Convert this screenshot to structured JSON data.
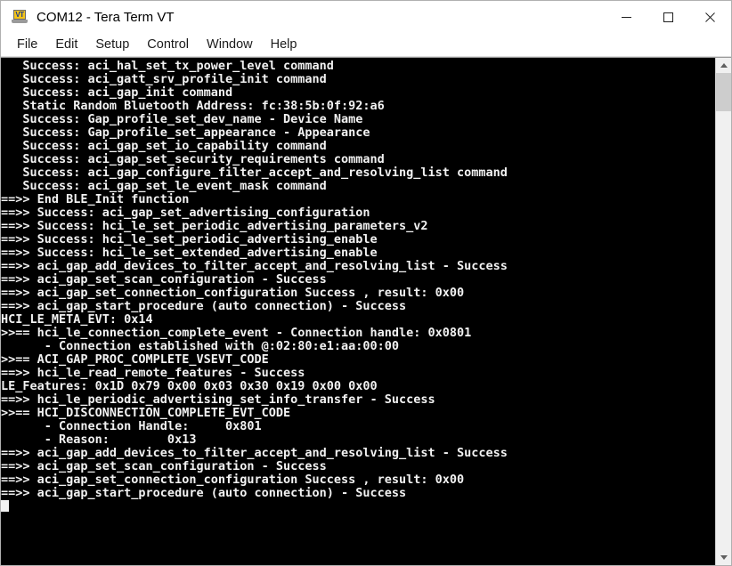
{
  "window": {
    "title": "COM12 - Tera Term VT",
    "icon": "vt-terminal-icon",
    "controls": {
      "minimize": "—",
      "maximize": "□",
      "close": "✕"
    }
  },
  "menubar": {
    "items": [
      {
        "label": "File"
      },
      {
        "label": "Edit"
      },
      {
        "label": "Setup"
      },
      {
        "label": "Control"
      },
      {
        "label": "Window"
      },
      {
        "label": "Help"
      }
    ]
  },
  "terminal": {
    "foreground": "#f2f2f2",
    "background": "#000000",
    "cursor_visible": true,
    "lines": [
      "   Success: aci_hal_set_tx_power_level command",
      "   Success: aci_gatt_srv_profile_init command",
      "   Success: aci_gap_init command",
      "   Static Random Bluetooth Address: fc:38:5b:0f:92:a6",
      "   Success: Gap_profile_set_dev_name - Device Name",
      "   Success: Gap_profile_set_appearance - Appearance",
      "   Success: aci_gap_set_io_capability command",
      "   Success: aci_gap_set_security_requirements command",
      "   Success: aci_gap_configure_filter_accept_and_resolving_list command",
      "   Success: aci_gap_set_le_event_mask command",
      "==>> End BLE_Init function",
      "==>> Success: aci_gap_set_advertising_configuration",
      "==>> Success: hci_le_set_periodic_advertising_parameters_v2",
      "==>> Success: hci_le_set_periodic_advertising_enable",
      "==>> Success: hci_le_set_extended_advertising_enable",
      "==>> aci_gap_add_devices_to_filter_accept_and_resolving_list - Success",
      "==>> aci_gap_set_scan_configuration - Success",
      "==>> aci_gap_set_connection_configuration Success , result: 0x00",
      "==>> aci_gap_start_procedure (auto connection) - Success",
      "HCI_LE_META_EVT: 0x14",
      ">>== hci_le_connection_complete_event - Connection handle: 0x0801",
      "      - Connection established with @:02:80:e1:aa:00:00",
      ">>== ACI_GAP_PROC_COMPLETE_VSEVT_CODE",
      "==>> hci_le_read_remote_features - Success",
      "LE_Features: 0x1D 0x79 0x00 0x03 0x30 0x19 0x00 0x00",
      "==>> hci_le_periodic_advertising_set_info_transfer - Success",
      ">>== HCI_DISCONNECTION_COMPLETE_EVT_CODE",
      "      - Connection Handle:     0x801",
      "      - Reason:        0x13",
      "==>> aci_gap_add_devices_to_filter_accept_and_resolving_list - Success",
      "==>> aci_gap_set_scan_configuration - Success",
      "==>> aci_gap_set_connection_configuration Success , result: 0x00",
      "==>> aci_gap_start_procedure (auto connection) - Success"
    ]
  },
  "scrollbar": {
    "up_arrow": "scroll-up-icon",
    "down_arrow": "scroll-down-icon",
    "thumb_position_pct": 0,
    "thumb_size_pct": 8
  }
}
